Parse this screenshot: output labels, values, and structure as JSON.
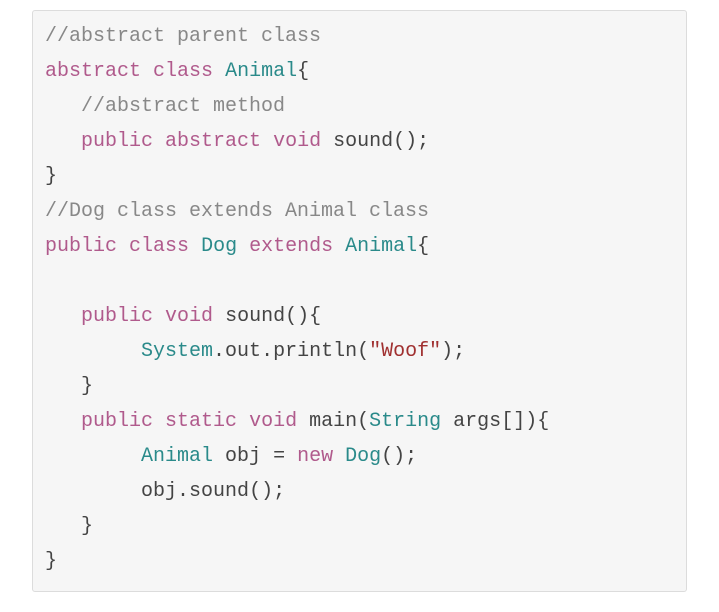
{
  "code": {
    "c1": "//abstract parent class",
    "kw_abstract1": "abstract",
    "kw_class1": "class",
    "ty_Animal1": "Animal",
    "ob1": "{",
    "c2": "//abstract method",
    "kw_public1": "public",
    "kw_abstract2": "abstract",
    "kw_void1": "void",
    "m_sound1": "sound",
    "p1": "();",
    "cb1": "}",
    "c3": "//Dog class extends Animal class",
    "kw_public2": "public",
    "kw_class2": "class",
    "ty_Dog1": "Dog",
    "kw_extends": "extends",
    "ty_Animal2": "Animal",
    "ob2": "{",
    "kw_public3": "public",
    "kw_void2": "void",
    "m_sound2": "sound",
    "p2": "(){",
    "ty_System": "System",
    "dot1": ".",
    "m_out": "out",
    "dot2": ".",
    "m_println": "println",
    "p3": "(",
    "s_woof": "\"Woof\"",
    "p4": ");",
    "cb2": "}",
    "kw_public4": "public",
    "kw_static": "static",
    "kw_void3": "void",
    "m_main": "main",
    "p5": "(",
    "ty_String": "String",
    "m_args": "args",
    "p6": "[]){",
    "ty_Animal3": "Animal",
    "m_obj1": "obj",
    "eq": " = ",
    "kw_new": "new",
    "ty_Dog2": "Dog",
    "p7": "();",
    "m_obj2": "obj",
    "dot3": ".",
    "m_sound3": "sound",
    "p8": "();",
    "cb3": "}",
    "cb4": "}"
  }
}
